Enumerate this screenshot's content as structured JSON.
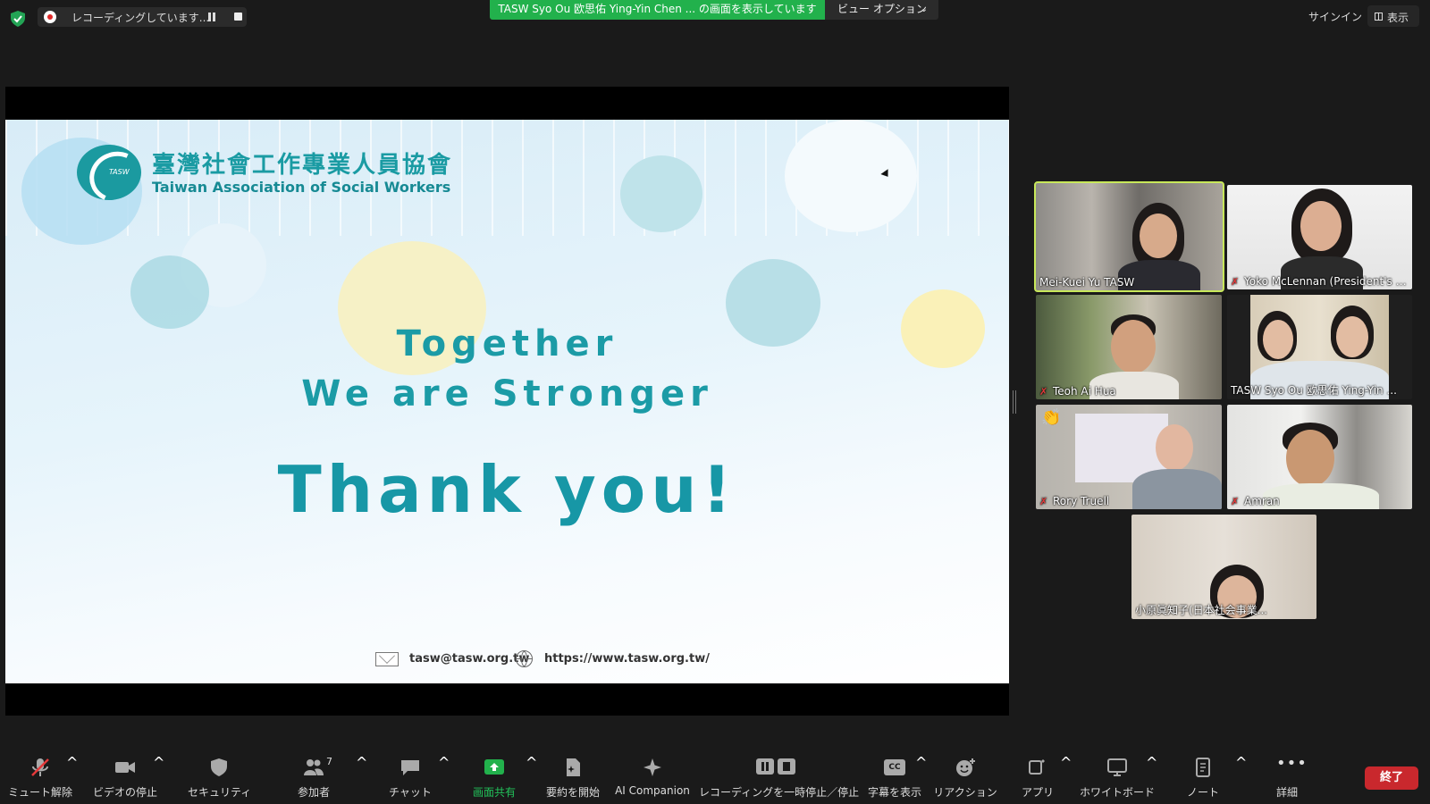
{
  "topbar": {
    "recording_text": "レコーディングしています...",
    "share_banner": "TASW Syo Ou 欧思佑 Ying-Yin Chen ... の画面を表示しています",
    "view_options": "ビュー オプション",
    "signin": "サインイン",
    "view": "表示"
  },
  "slide": {
    "org_cn": "臺灣社會工作專業人員協會",
    "org_en": "Taiwan Association of Social Workers",
    "logo_mark": "TASW",
    "tagline1": "Together",
    "tagline2": "We are Stronger",
    "thanks": "Thank you!",
    "email": "tasw@tasw.org.tw",
    "url": "https://www.tasw.org.tw/"
  },
  "participants": [
    {
      "name": "Mei-Kuei Yu TASW",
      "muted": false,
      "active": true
    },
    {
      "name": "Yoko McLennan (President's S...",
      "muted": true
    },
    {
      "name": "Teoh Ai Hua",
      "muted": true
    },
    {
      "name": "TASW Syo Ou 欧思佑 Ying-Yin ...",
      "muted": false
    },
    {
      "name": "Rory Truell",
      "muted": true,
      "reaction": "👏"
    },
    {
      "name": "Amran",
      "muted": true
    },
    {
      "name": "小原眞知子(日本社会事業...",
      "muted": false
    }
  ],
  "toolbar": {
    "unmute": "ミュート解除",
    "stop_video": "ビデオの停止",
    "security": "セキュリティ",
    "participants": "参加者",
    "participants_count": "7",
    "chat": "チャット",
    "share": "画面共有",
    "summary": "要約を開始",
    "ai": "AI Companion",
    "recording": "レコーディングを一時停止／停止",
    "captions": "字幕を表示",
    "cc": "CC",
    "reactions": "リアクション",
    "apps": "アプリ",
    "whiteboard": "ホワイトボード",
    "notes": "ノート",
    "more": "詳細",
    "end": "終了"
  },
  "colors": {
    "share_banner": "#22b14c",
    "active_speaker": "#c8e85a",
    "end_button": "#c9282d",
    "slide_accent": "#1b9ba6"
  }
}
